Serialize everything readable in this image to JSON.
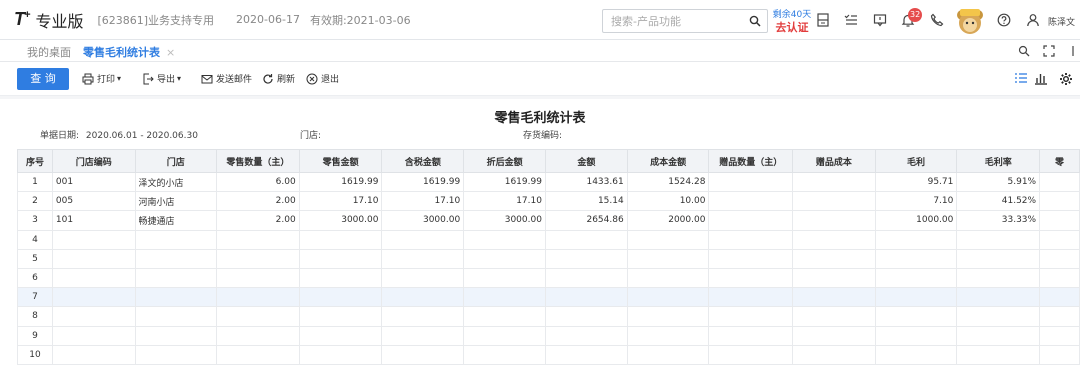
{
  "app": {
    "logo": "T",
    "logo_sup": "+",
    "brand": "专业版",
    "account": "[623861]业务支持专用",
    "date": "2020-06-17",
    "valid_until": "有效期:2021-03-06",
    "search_placeholder": "搜索-产品功能",
    "trial_days": "剩余40天",
    "trial_action": "去认证",
    "notifications": "32",
    "user": "陈泽文"
  },
  "tabs": [
    {
      "label": "我的桌面"
    },
    {
      "label": "零售毛利统计表",
      "close": "×"
    }
  ],
  "toolbar": {
    "query": "查 询",
    "print": "打印",
    "export": "导出",
    "email": "发送邮件",
    "refresh": "刷新",
    "exit": "退出"
  },
  "report": {
    "title": "零售毛利统计表",
    "date_label": "单据日期:",
    "date_value": "2020.06.01 - 2020.06.30",
    "store_label": "门店:",
    "inv_label": "存货编码:"
  },
  "table": {
    "headers": [
      "序号",
      "门店编码",
      "门店",
      "零售数量（主）",
      "零售金额",
      "含税金额",
      "折后金额",
      "金额",
      "成本金额",
      "赠品数量（主）",
      "赠品成本",
      "毛利",
      "毛利率",
      "零"
    ],
    "rows": [
      [
        "1",
        "001",
        "泽文的小店",
        "6.00",
        "1619.99",
        "1619.99",
        "1619.99",
        "1433.61",
        "1524.28",
        "",
        "",
        "95.71",
        "5.91%",
        ""
      ],
      [
        "2",
        "005",
        "河南小店",
        "2.00",
        "17.10",
        "17.10",
        "17.10",
        "15.14",
        "10.00",
        "",
        "",
        "7.10",
        "41.52%",
        ""
      ],
      [
        "3",
        "101",
        "畅捷通店",
        "2.00",
        "3000.00",
        "3000.00",
        "3000.00",
        "2654.86",
        "2000.00",
        "",
        "",
        "1000.00",
        "33.33%",
        ""
      ],
      [
        "4",
        "",
        "",
        "",
        "",
        "",
        "",
        "",
        "",
        "",
        "",
        "",
        "",
        ""
      ],
      [
        "5",
        "",
        "",
        "",
        "",
        "",
        "",
        "",
        "",
        "",
        "",
        "",
        "",
        ""
      ],
      [
        "6",
        "",
        "",
        "",
        "",
        "",
        "",
        "",
        "",
        "",
        "",
        "",
        "",
        ""
      ],
      [
        "7",
        "",
        "",
        "",
        "",
        "",
        "",
        "",
        "",
        "",
        "",
        "",
        "",
        ""
      ],
      [
        "8",
        "",
        "",
        "",
        "",
        "",
        "",
        "",
        "",
        "",
        "",
        "",
        "",
        ""
      ],
      [
        "9",
        "",
        "",
        "",
        "",
        "",
        "",
        "",
        "",
        "",
        "",
        "",
        "",
        ""
      ],
      [
        "10",
        "",
        "",
        "",
        "",
        "",
        "",
        "",
        "",
        "",
        "",
        "",
        "",
        ""
      ]
    ]
  },
  "colors": {
    "accent": "#2f7de1",
    "alert": "#e23c3c"
  }
}
